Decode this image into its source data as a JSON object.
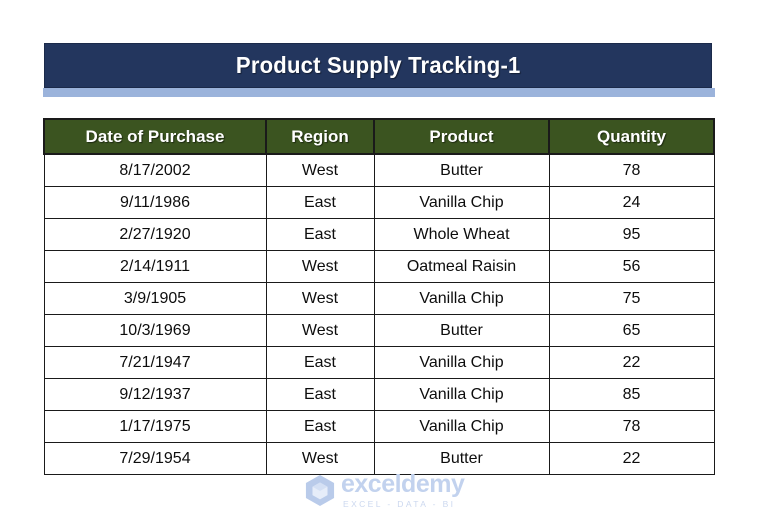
{
  "banner": {
    "title": "Product Supply Tracking-1",
    "background_color": "#23365e",
    "underbar_color": "#9bb3db",
    "text_color": "#ffffff"
  },
  "table": {
    "header_background": "#3b5420",
    "header_text_color": "#ffffff",
    "border_color": "#1a1a1a",
    "columns": [
      "Date of Purchase",
      "Region",
      "Product",
      "Quantity"
    ],
    "rows": [
      {
        "date": "8/17/2002",
        "region": "West",
        "product": "Butter",
        "quantity": "78"
      },
      {
        "date": "9/11/1986",
        "region": "East",
        "product": "Vanilla Chip",
        "quantity": "24"
      },
      {
        "date": "2/27/1920",
        "region": "East",
        "product": "Whole Wheat",
        "quantity": "95"
      },
      {
        "date": "2/14/1911",
        "region": "West",
        "product": "Oatmeal Raisin",
        "quantity": "56"
      },
      {
        "date": "3/9/1905",
        "region": "West",
        "product": "Vanilla Chip",
        "quantity": "75"
      },
      {
        "date": "10/3/1969",
        "region": "West",
        "product": "Butter",
        "quantity": "65"
      },
      {
        "date": "7/21/1947",
        "region": "East",
        "product": "Vanilla Chip",
        "quantity": "22"
      },
      {
        "date": "9/12/1937",
        "region": "East",
        "product": "Vanilla Chip",
        "quantity": "85"
      },
      {
        "date": "1/17/1975",
        "region": "East",
        "product": "Vanilla Chip",
        "quantity": "78"
      },
      {
        "date": "7/29/1954",
        "region": "West",
        "product": "Butter",
        "quantity": "22"
      }
    ]
  },
  "watermark": {
    "wordmark": "exceldemy",
    "tagline": "EXCEL - DATA - BI",
    "logo_icon": "cube-logo-icon",
    "color": "#c2d2ee"
  }
}
